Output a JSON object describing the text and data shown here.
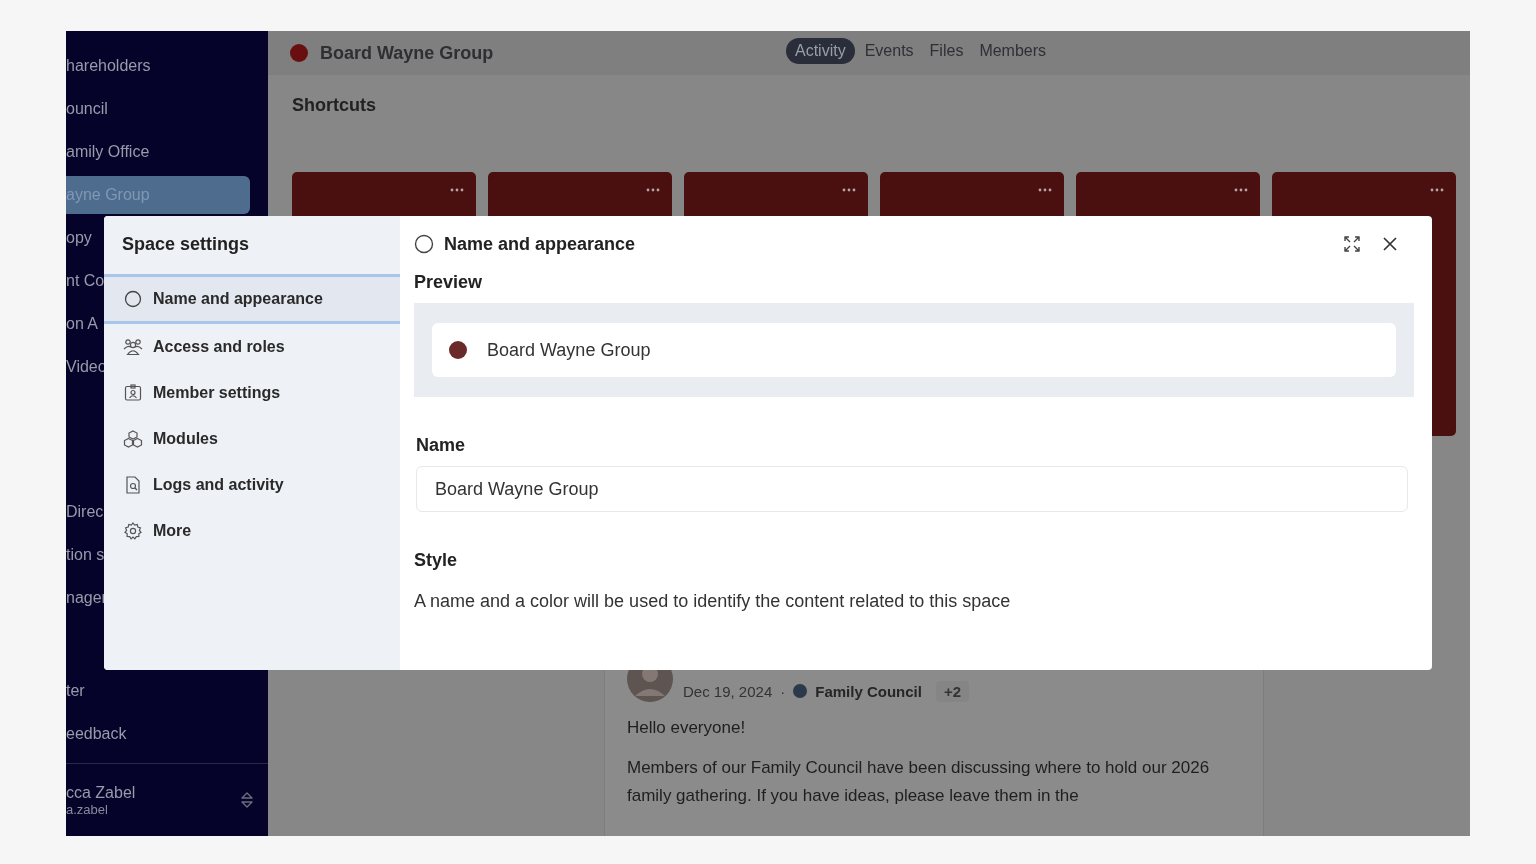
{
  "sidebar": {
    "sections": [
      {
        "items": [
          {
            "label": "hareholders",
            "selected": false
          },
          {
            "label": "ouncil",
            "selected": false
          },
          {
            "label": "amily Office",
            "selected": false
          },
          {
            "label": "ayne Group",
            "selected": true
          },
          {
            "label": "opy",
            "selected": false
          },
          {
            "label": "nt Co",
            "selected": false
          },
          {
            "label": "on A",
            "selected": false
          },
          {
            "label": "Video",
            "selected": false
          }
        ]
      },
      {
        "items": [
          {
            "label": "Direc",
            "selected": false
          },
          {
            "label": "tion s",
            "selected": false
          },
          {
            "label": "nager",
            "selected": false
          }
        ]
      },
      {
        "items": [
          {
            "label": "ter",
            "selected": false
          },
          {
            "label": "eedback",
            "selected": false
          }
        ]
      }
    ],
    "user": {
      "name": "cca Zabel",
      "email": "a.zabel"
    }
  },
  "header": {
    "title": "Board Wayne Group",
    "tabs": [
      {
        "label": "Activity",
        "selected": true
      },
      {
        "label": "Events",
        "selected": false
      },
      {
        "label": "Files",
        "selected": false
      },
      {
        "label": "Members",
        "selected": false
      }
    ]
  },
  "shortcuts": {
    "title": "Shortcuts",
    "cards": [
      {
        "kind": "card"
      },
      {
        "kind": "card"
      },
      {
        "kind": "card"
      },
      {
        "kind": "card"
      },
      {
        "kind": "card"
      },
      {
        "kind": "card"
      }
    ]
  },
  "post": {
    "date": "Dec 19, 2024",
    "separator": "·",
    "tag": {
      "label": "Family Council",
      "color": "#2b3a4a"
    },
    "extra": "+2",
    "paragraphs": [
      "Hello everyone!",
      "Members of our Family Council have been discussing where to hold our 2026 family gathering. If you have ideas, please leave them in the"
    ]
  },
  "modal": {
    "title": "Space settings",
    "nav": [
      {
        "label": "Name and appearance",
        "kind": "appearance",
        "selected": true
      },
      {
        "label": "Access and roles",
        "kind": "access",
        "selected": false
      },
      {
        "label": "Member settings",
        "kind": "members",
        "selected": false
      },
      {
        "label": "Modules",
        "kind": "modules",
        "selected": false
      },
      {
        "label": "Logs and activity",
        "kind": "logs",
        "selected": false
      },
      {
        "label": "More",
        "kind": "more",
        "selected": false
      }
    ],
    "panel": {
      "title": "Name and appearance",
      "preview_label": "Preview",
      "preview_name": "Board Wayne Group",
      "name_label": "Name",
      "name_value": "Board Wayne Group",
      "style_label": "Style",
      "style_description": "A name and a color will be used to identify the content related to this space"
    }
  }
}
